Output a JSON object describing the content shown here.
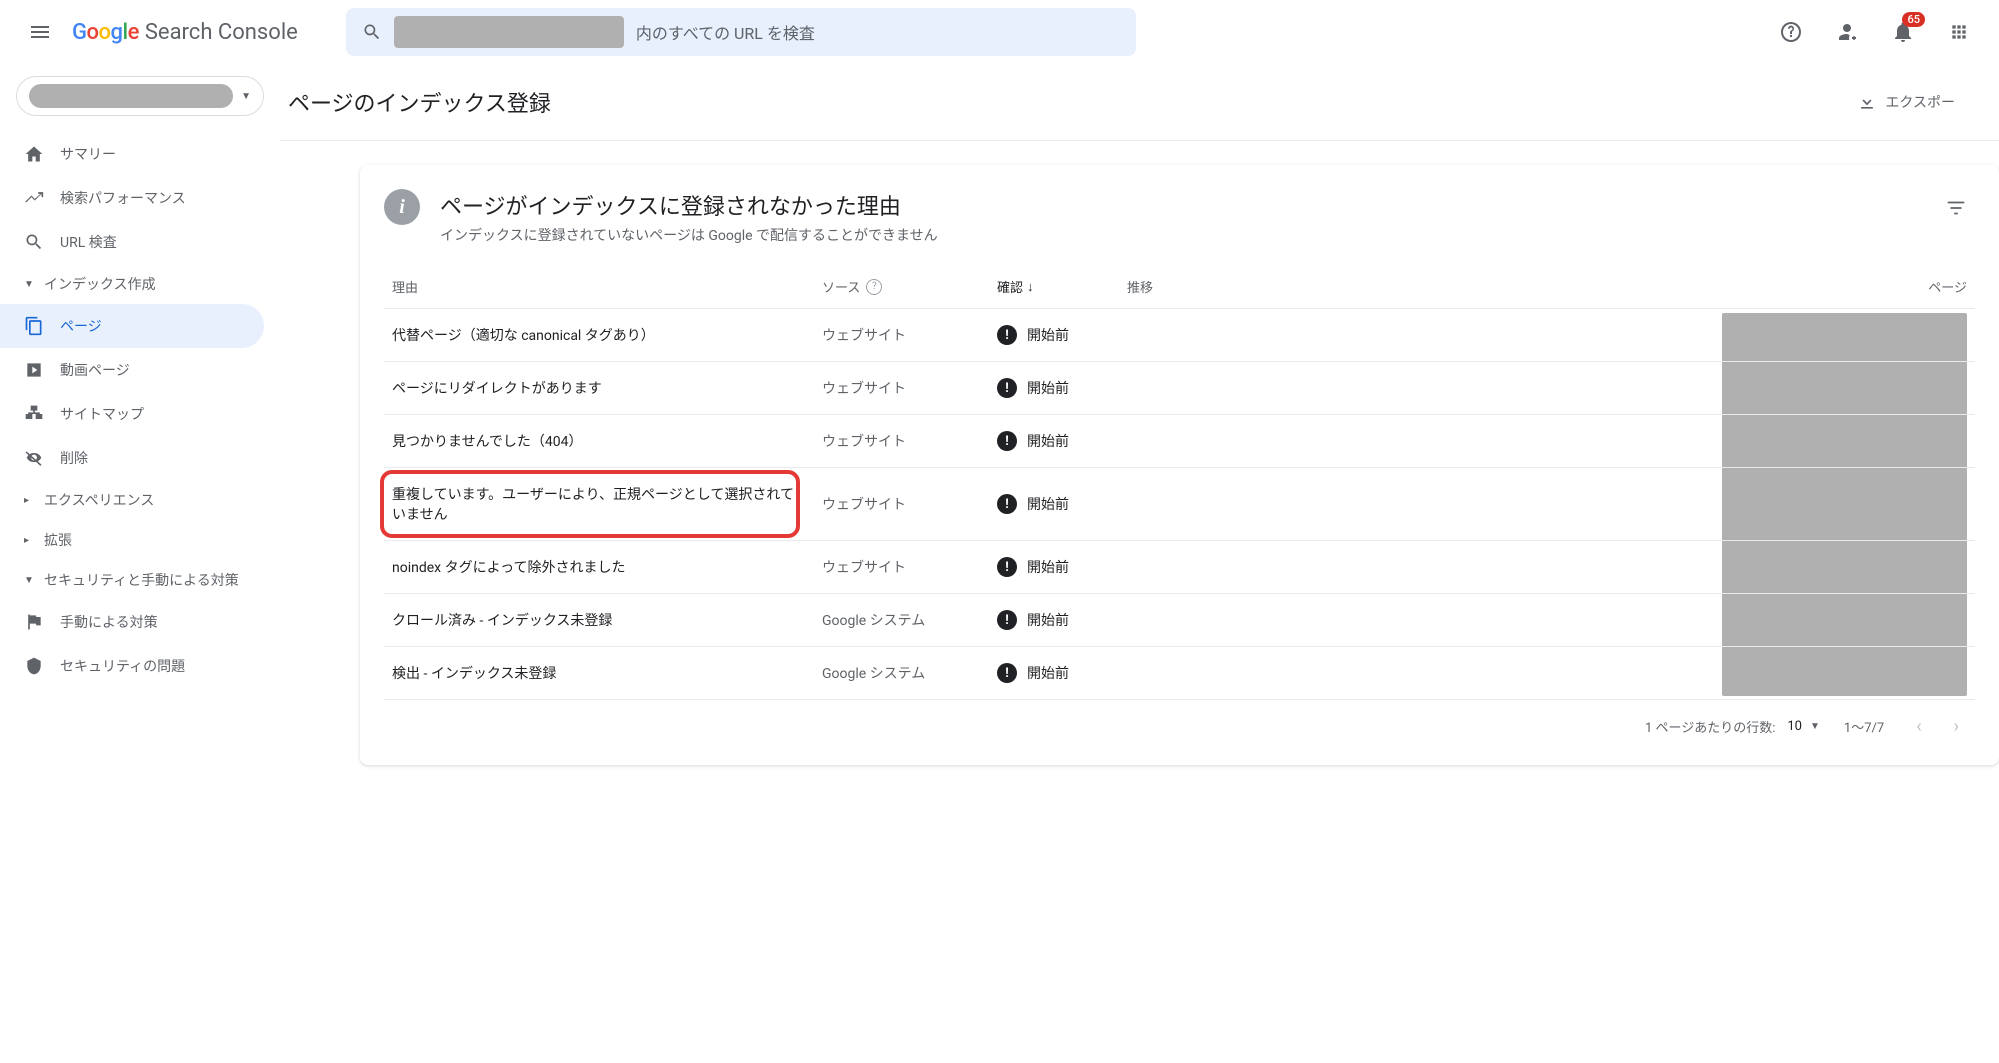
{
  "header": {
    "product_name": "Search Console",
    "search_placeholder": "内のすべての URL を検査",
    "notification_count": "65"
  },
  "sidebar": {
    "items": [
      {
        "label": "サマリー",
        "icon": "home"
      },
      {
        "label": "検索パフォーマンス",
        "icon": "trend"
      },
      {
        "label": "URL 検査",
        "icon": "search"
      }
    ],
    "sections": [
      {
        "label": "インデックス作成",
        "expanded": true,
        "items": [
          {
            "label": "ページ",
            "icon": "pages",
            "active": true
          },
          {
            "label": "動画ページ",
            "icon": "video"
          },
          {
            "label": "サイトマップ",
            "icon": "sitemap"
          },
          {
            "label": "削除",
            "icon": "remove"
          }
        ]
      },
      {
        "label": "エクスペリエンス",
        "expanded": false
      },
      {
        "label": "拡張",
        "expanded": false
      },
      {
        "label": "セキュリティと手動による対策",
        "expanded": true,
        "items": [
          {
            "label": "手動による対策",
            "icon": "flag"
          },
          {
            "label": "セキュリティの問題",
            "icon": "shield"
          }
        ]
      }
    ]
  },
  "page": {
    "title": "ページのインデックス登録",
    "export": "エクスポー"
  },
  "card": {
    "title": "ページがインデックスに登録されなかった理由",
    "subtitle": "インデックスに登録されていないページは Google で配信することができません",
    "columns": {
      "reason": "理由",
      "source": "ソース",
      "confirm": "確認",
      "trend": "推移",
      "pages": "ページ"
    },
    "rows": [
      {
        "reason": "代替ページ（適切な canonical タグあり）",
        "source": "ウェブサイト",
        "status": "開始前"
      },
      {
        "reason": "ページにリダイレクトがあります",
        "source": "ウェブサイト",
        "status": "開始前"
      },
      {
        "reason": "見つかりませんでした（404）",
        "source": "ウェブサイト",
        "status": "開始前"
      },
      {
        "reason": "重複しています。ユーザーにより、正規ページとして選択されていません",
        "source": "ウェブサイト",
        "status": "開始前",
        "highlight": true
      },
      {
        "reason": "noindex タグによって除外されました",
        "source": "ウェブサイト",
        "status": "開始前"
      },
      {
        "reason": "クロール済み - インデックス未登録",
        "source": "Google システム",
        "status": "開始前"
      },
      {
        "reason": "検出 - インデックス未登録",
        "source": "Google システム",
        "status": "開始前"
      }
    ],
    "pagination": {
      "rows_per_page_label": "1 ページあたりの行数:",
      "rows_per_page": "10",
      "range": "1～7/7"
    }
  }
}
